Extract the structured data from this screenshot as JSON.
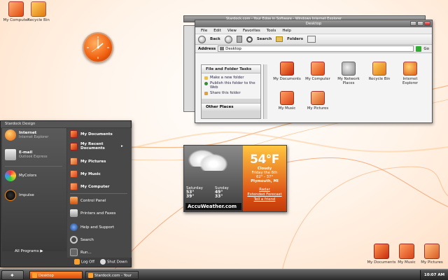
{
  "desktop_icons_top": [
    {
      "label": "My Computer"
    },
    {
      "label": "Recycle Bin"
    }
  ],
  "desktop_icons_bottom": [
    {
      "label": "My Documents"
    },
    {
      "label": "My Music"
    },
    {
      "label": "My Pictures"
    }
  ],
  "browser_window": {
    "title": "Stardock.com - Your Edge in Software - Windows Internet Explorer"
  },
  "explorer": {
    "title": "Desktop",
    "menu": [
      "File",
      "Edit",
      "View",
      "Favorites",
      "Tools",
      "Help"
    ],
    "toolbar": {
      "back": "Back",
      "search": "Search",
      "folders": "Folders"
    },
    "address": {
      "label": "Address",
      "value": "Desktop",
      "go": "Go"
    },
    "tasks_header": "File and Folder Tasks",
    "tasks": [
      "Make a new folder",
      "Publish this folder to the Web",
      "Share this folder"
    ],
    "other_header": "Other Places",
    "files": [
      {
        "label": "My Documents"
      },
      {
        "label": "My Computer"
      },
      {
        "label": "My Network Places"
      },
      {
        "label": "Recycle Bin"
      },
      {
        "label": "Internet Explorer"
      },
      {
        "label": "My Music"
      },
      {
        "label": "My Pictures"
      }
    ]
  },
  "start_menu": {
    "user": "Stardock Design",
    "pinned": [
      {
        "title": "Internet",
        "sub": "Internet Explorer"
      },
      {
        "title": "E-mail",
        "sub": "Outlook Express"
      }
    ],
    "recent": [
      {
        "title": "MyColors"
      },
      {
        "title": "Impulse"
      }
    ],
    "all_programs": "All Programs",
    "right": [
      "My Documents",
      "My Recent Documents",
      "My Pictures",
      "My Music",
      "My Computer",
      "Control Panel",
      "Printers and Faxes",
      "Help and Support",
      "Search",
      "Run..."
    ],
    "logoff": "Log Off",
    "shutdown": "Shut Down"
  },
  "weather": {
    "temp": "54°F",
    "condition": "Cloudy",
    "date": "Friday the 6th",
    "range": "62° - 37°",
    "city": "Plymouth, MI",
    "link_radar": "Radar",
    "link_forecast": "Extended Forecast",
    "link_friend": "Tell a friend",
    "forecast": [
      {
        "day": "Saturday",
        "hi": "53°",
        "lo": "39°"
      },
      {
        "day": "Sunday",
        "hi": "49°",
        "lo": "33°"
      }
    ],
    "brand": "AccuWeather.com"
  },
  "taskbar": {
    "tasks": [
      "Desktop",
      "Stardock.com - Your Ed..."
    ],
    "clock": "10:07 AM"
  }
}
